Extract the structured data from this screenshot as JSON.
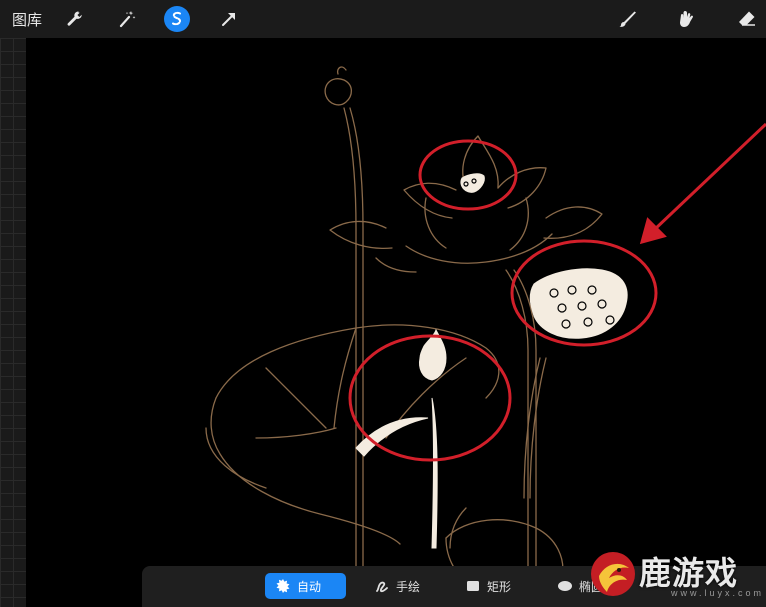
{
  "toolbar": {
    "gallery_label": "图库",
    "left_tools": [
      "wrench-icon",
      "magic-wand-icon",
      "selection-icon",
      "transform-arrow-icon"
    ],
    "active_tool": "selection-icon",
    "right_tools": [
      "brush-icon",
      "smudge-icon",
      "eraser-icon"
    ]
  },
  "selection_bar": {
    "options": [
      {
        "label": "自动",
        "icon": "auto-burst-icon",
        "active": true
      },
      {
        "label": "手绘",
        "icon": "freehand-icon",
        "active": false
      },
      {
        "label": "矩形",
        "icon": "rectangle-icon",
        "active": false
      },
      {
        "label": "椭圆",
        "icon": "ellipse-icon",
        "active": false
      }
    ]
  },
  "annotations": {
    "circle_color": "#d21f2a",
    "arrow_color": "#d21f2a"
  },
  "artwork": {
    "line_color": "#8a6a4a",
    "fill_color": "#f4ece0"
  },
  "watermark": {
    "text": "鹿游戏",
    "sub": "www.luyx.com"
  },
  "colors": {
    "accent": "#1b86f5",
    "toolbar_bg": "#1b1b1b"
  }
}
